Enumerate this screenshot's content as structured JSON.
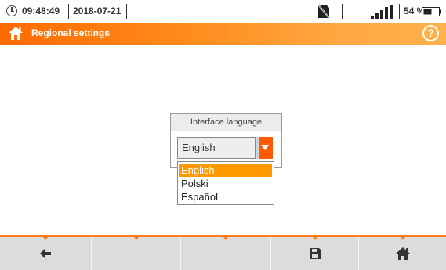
{
  "status": {
    "time": "09:48:49",
    "date": "2018-07-21",
    "battery": "54 %"
  },
  "titlebar": {
    "title": "Regional settings",
    "help": "?"
  },
  "dialog": {
    "heading": "Interface language",
    "selected": "English",
    "options": [
      "English",
      "Polski",
      "Español"
    ]
  },
  "icons": {
    "status": [
      "clock-icon",
      "sd-card-icon",
      "signal-icon",
      "battery-icon"
    ],
    "titlebar": [
      "home-icon",
      "help-icon"
    ],
    "bottom": [
      "back-arrow-icon",
      "save-icon",
      "home-icon"
    ]
  },
  "colors": {
    "accent": "#ff6a00",
    "selection": "#ff9900",
    "bottom_bar": "#dcdcdc"
  }
}
